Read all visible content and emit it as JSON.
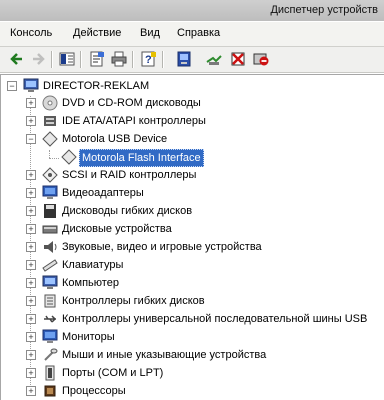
{
  "window": {
    "title": "Диспетчер устройств"
  },
  "menu": [
    "Консоль",
    "Действие",
    "Вид",
    "Справка"
  ],
  "toolbar": {
    "icons": [
      "back-icon",
      "forward-icon",
      "show-hide-tree-icon",
      "properties-icon",
      "print-icon",
      "help-icon",
      "scan-hardware-icon",
      "update-driver-icon",
      "disable-device-icon",
      "uninstall-device-icon"
    ]
  },
  "tree": {
    "root": "DIRECTOR-REKLAM",
    "items": [
      "DVD и CD-ROM дисководы",
      "IDE ATA/ATAPI контроллеры",
      "Motorola USB Device",
      "Motorola Flash Interface",
      "SCSI и RAID контроллеры",
      "Видеоадаптеры",
      "Дисководы гибких дисков",
      "Дисковые устройства",
      "Звуковые, видео и игровые устройства",
      "Клавиатуры",
      "Компьютер",
      "Контроллеры гибких дисков",
      "Контроллеры универсальной последовательной шины USB",
      "Мониторы",
      "Мыши и иные указывающие устройства",
      "Порты (COM и LPT)",
      "Процессоры"
    ],
    "selected": "Motorola Flash Interface"
  },
  "colors": {
    "selection": "#316ac5",
    "menubar": "#f3f3f0",
    "toolbar": "#f0f0ee"
  }
}
